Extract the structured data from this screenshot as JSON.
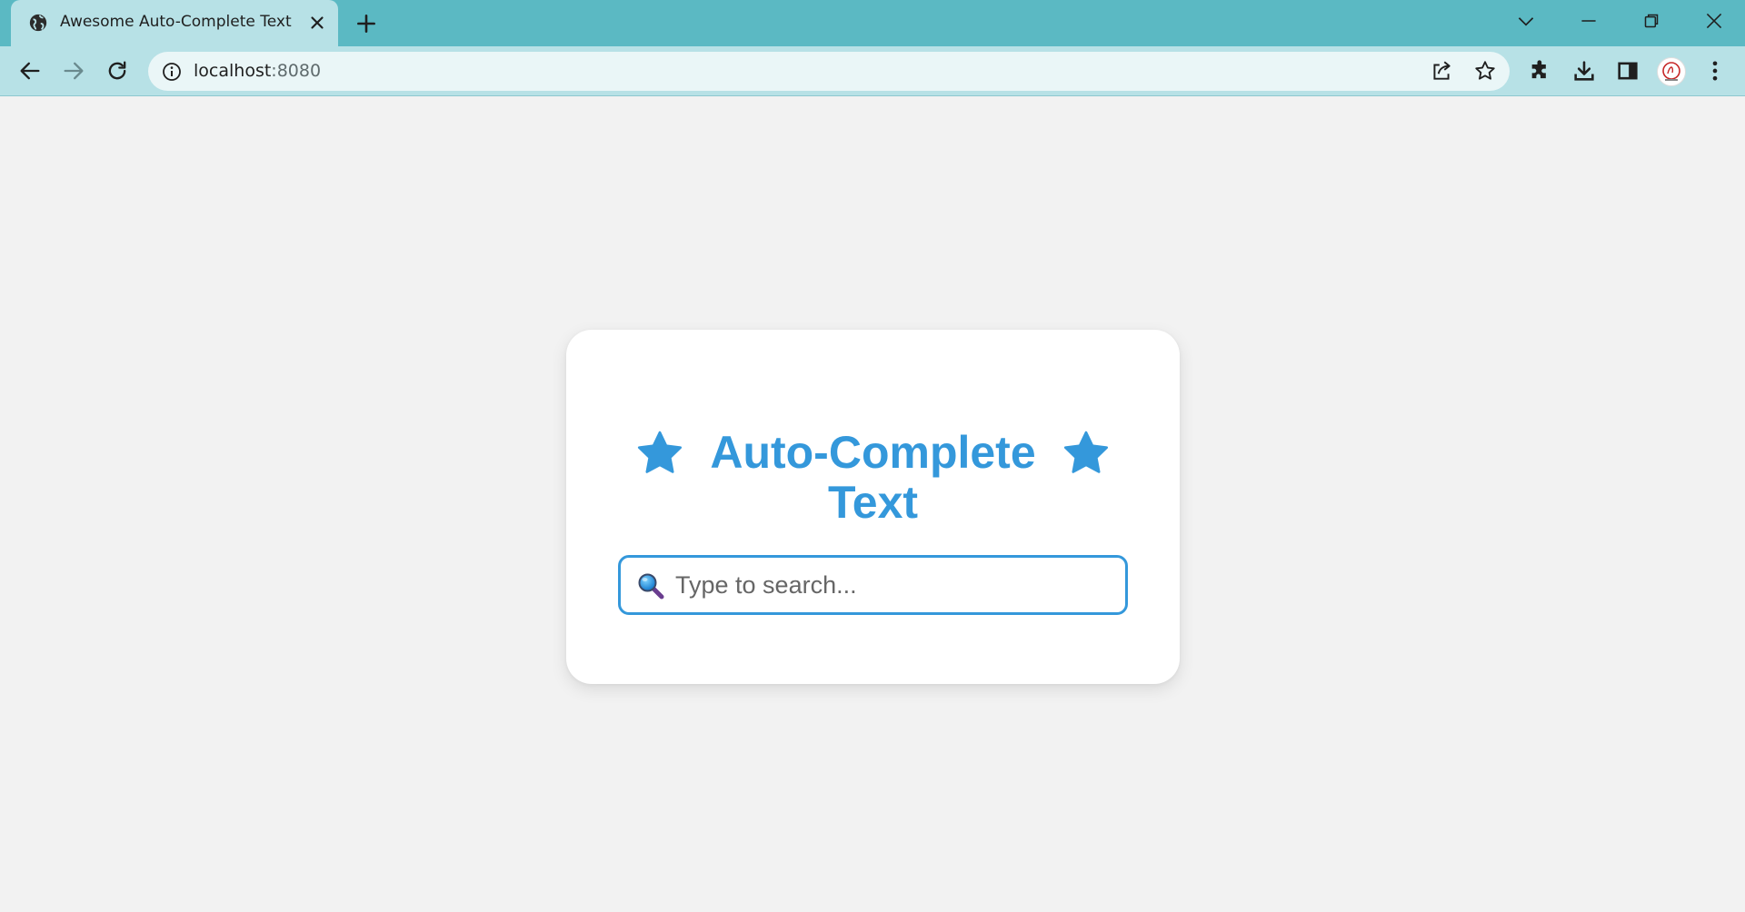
{
  "browser": {
    "tab": {
      "title": "Awesome Auto-Complete Text",
      "favicon": "globe-icon"
    },
    "address_bar": {
      "host": "localhost",
      "port": ":8080"
    },
    "colors": {
      "titlebar": "#5bb9c3",
      "toolbar": "#b7e1e6"
    }
  },
  "page": {
    "heading": {
      "line1": "Auto-Complete",
      "line2": "Text",
      "decoration_icon": "star-icon"
    },
    "search": {
      "icon": "magnifier-icon",
      "placeholder": "Type to search...",
      "value": ""
    },
    "colors": {
      "accent": "#3498db",
      "background": "#f2f2f2",
      "card": "#ffffff"
    }
  }
}
